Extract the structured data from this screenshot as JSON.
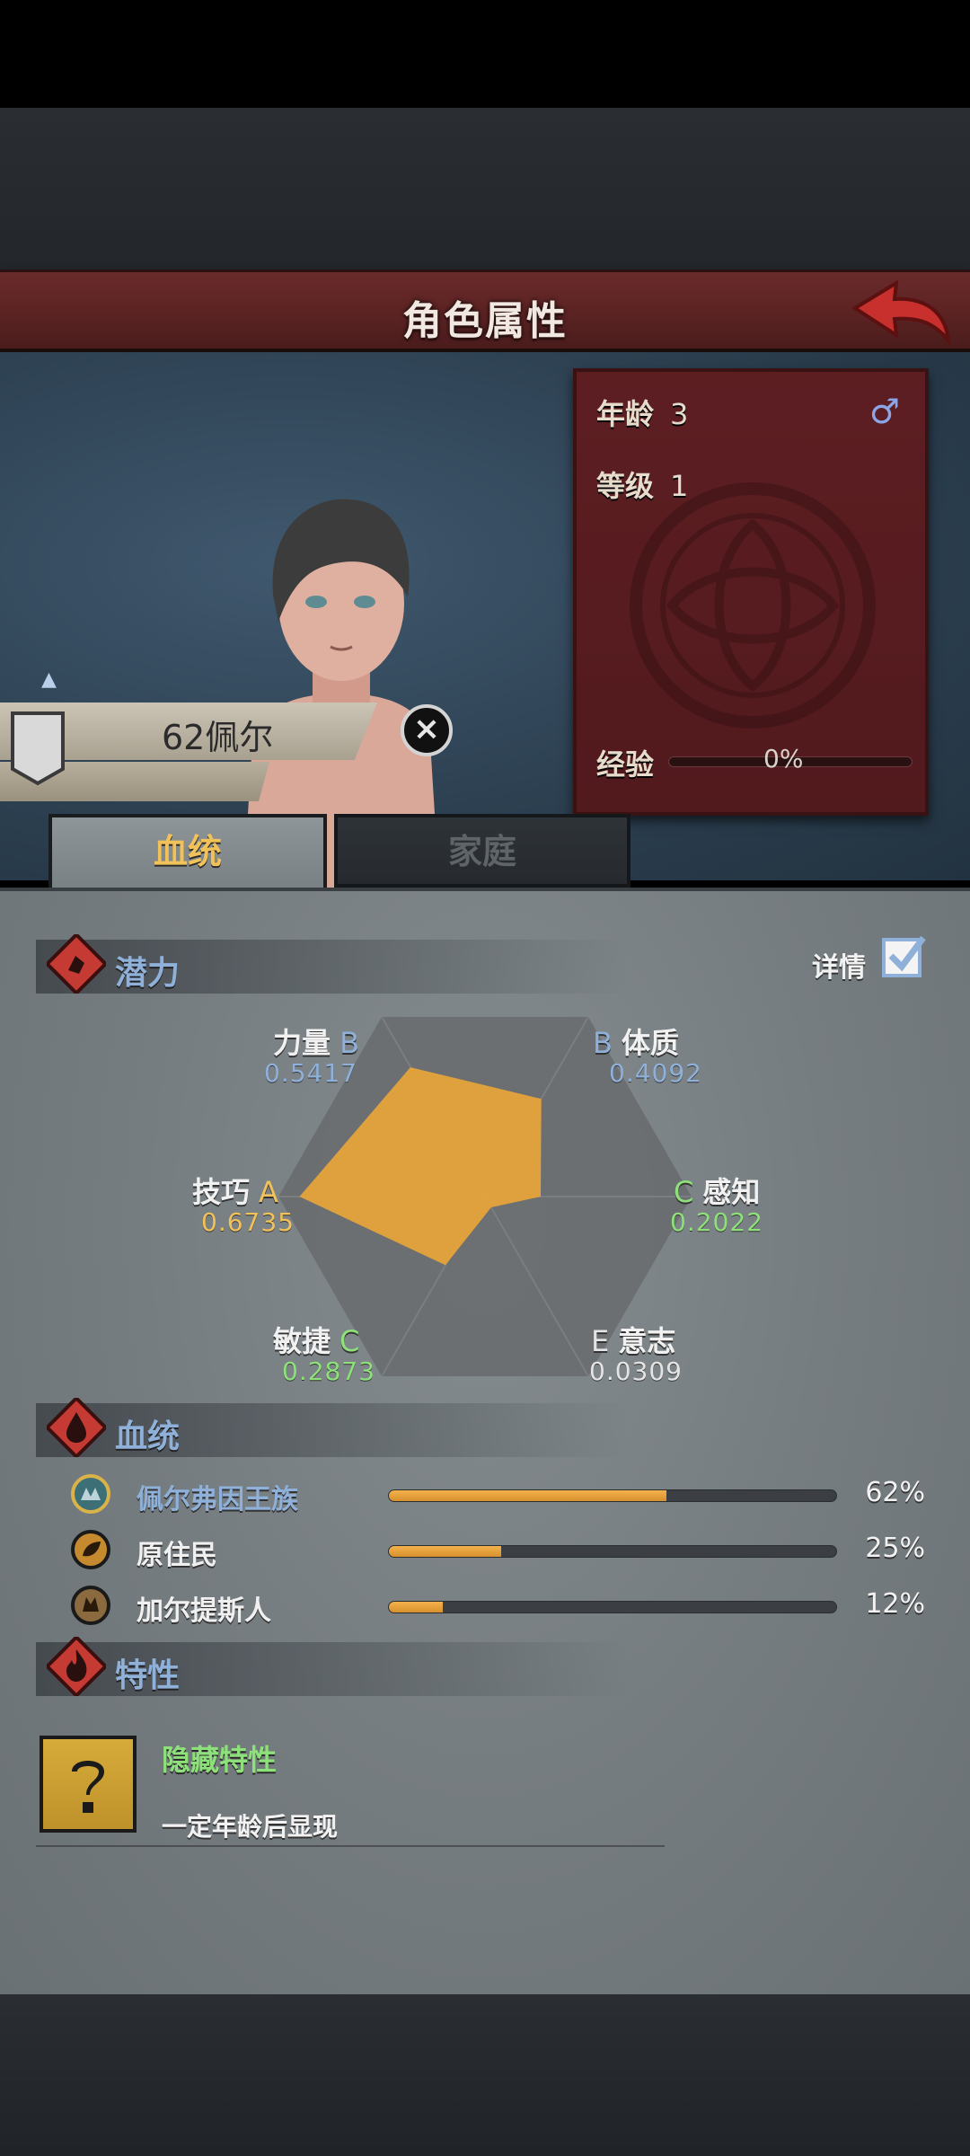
{
  "header": {
    "title": "角色属性"
  },
  "character": {
    "name": "62佩尔",
    "age_label": "年龄",
    "age": "3",
    "level_label": "等级",
    "level": "1",
    "exp_label": "经验",
    "exp_value": "0%"
  },
  "tabs": [
    {
      "label": "血统",
      "active": true
    },
    {
      "label": "家庭",
      "active": false
    }
  ],
  "potential": {
    "title": "潜力",
    "detail_label": "详情",
    "stats": [
      {
        "name": "力量",
        "grade": "B",
        "value": "0.5417",
        "color": "#8fb0d8"
      },
      {
        "name": "体质",
        "grade": "B",
        "value": "0.4092",
        "color": "#8fb0d8"
      },
      {
        "name": "感知",
        "grade": "C",
        "value": "0.2022",
        "color": "#8ee07a"
      },
      {
        "name": "意志",
        "grade": "E",
        "value": "0.0309",
        "color": "#e4e4e4"
      },
      {
        "name": "敏捷",
        "grade": "C",
        "value": "0.2873",
        "color": "#8ee07a"
      },
      {
        "name": "技巧",
        "grade": "A",
        "value": "0.6735",
        "color": "#f1c25a"
      }
    ]
  },
  "bloodline": {
    "title": "血统",
    "items": [
      {
        "name": "佩尔弗因王族",
        "percent": "62%",
        "fraction": 0.62,
        "highlight": true
      },
      {
        "name": "原住民",
        "percent": "25%",
        "fraction": 0.25,
        "highlight": false
      },
      {
        "name": "加尔提斯人",
        "percent": "12%",
        "fraction": 0.12,
        "highlight": false
      }
    ]
  },
  "traits": {
    "title": "特性",
    "item_name": "隐藏特性",
    "item_desc": "一定年龄后显现"
  },
  "colors": {
    "accent_gold": "#f1c25a",
    "title_red": "#5a2222",
    "radar_fill": "#e6a33a",
    "bar_fill": "#f4b24b"
  }
}
